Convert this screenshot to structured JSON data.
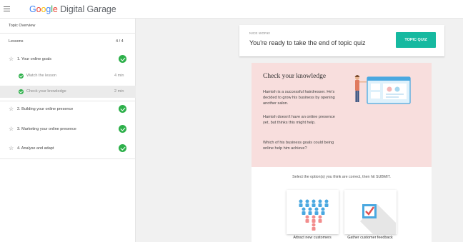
{
  "header": {
    "logo_google": [
      "G",
      "o",
      "o",
      "g",
      "l",
      "e"
    ],
    "logo_rest": "Digital Garage"
  },
  "sidebar": {
    "title": "Topic Overview",
    "lessons_label": "Lessons",
    "lessons_count": "4 / 4",
    "items": [
      {
        "label": "1. Your online goals"
      },
      {
        "label": "2. Building your online presence"
      },
      {
        "label": "3. Marketing your online presence"
      },
      {
        "label": "4. Analyse and adapt"
      }
    ],
    "subitems": [
      {
        "label": "Watch the lesson",
        "duration": "4 min"
      },
      {
        "label": "Check your knowledge",
        "duration": "2 min"
      }
    ]
  },
  "banner": {
    "small": "NICE WORK!",
    "text": "You're ready to take the end of topic quiz",
    "button": "TOPIC QUIZ"
  },
  "card": {
    "heading": "Check your knowledge",
    "paragraphs": [
      "Hamish is a successful hairdresser. He's decided to grow his business by opening another salon.",
      "Hamish doesn't have an online presence yet, but thinks this might help.",
      "Which of his business goals could being online help him achieve?"
    ],
    "instruction": "Select the option(s) you think are correct, then hit SUBMIT.",
    "options": [
      {
        "label": "Attract new customers"
      },
      {
        "label": "Gather customer feedback"
      }
    ]
  },
  "colors": {
    "accent": "#16b9a0",
    "check": "#2db04a",
    "pink_panel": "#f8dedd"
  }
}
